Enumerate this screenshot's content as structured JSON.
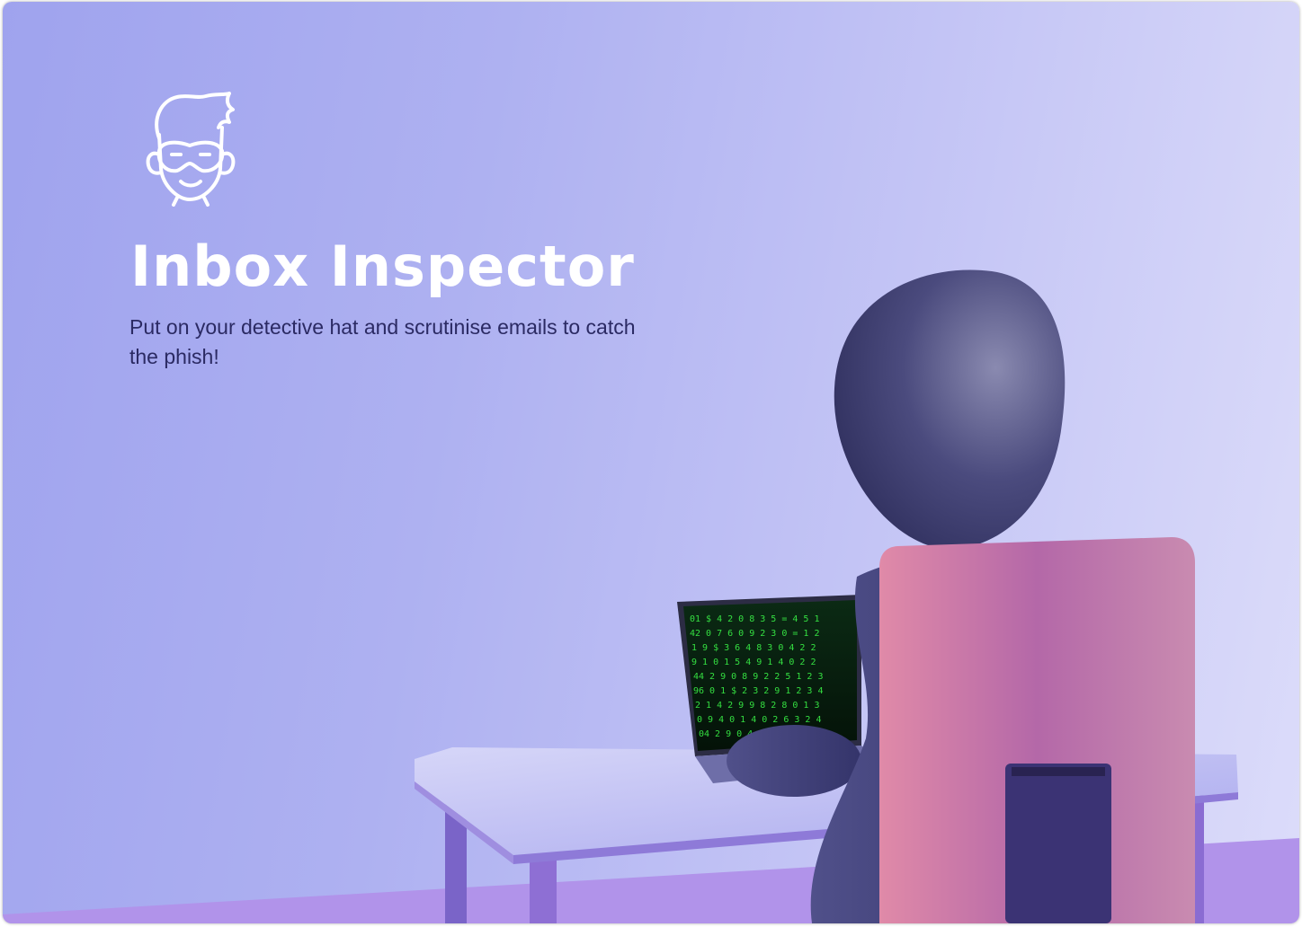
{
  "hero": {
    "title": "Inbox Inspector",
    "subtitle": "Put on your detective hat and scrutinise emails to catch the phish!",
    "logo_icon": "detective-mask-face-icon",
    "illustration": "hooded-figure-at-laptop-illustration"
  },
  "colors": {
    "background_start": "#9fa3ee",
    "background_end": "#dcdcfa",
    "title": "#ffffff",
    "subtitle": "#2b2a63",
    "chair": "#c27aa6",
    "figure": "#3a3a6e",
    "screen_code": "#3cff4a"
  }
}
